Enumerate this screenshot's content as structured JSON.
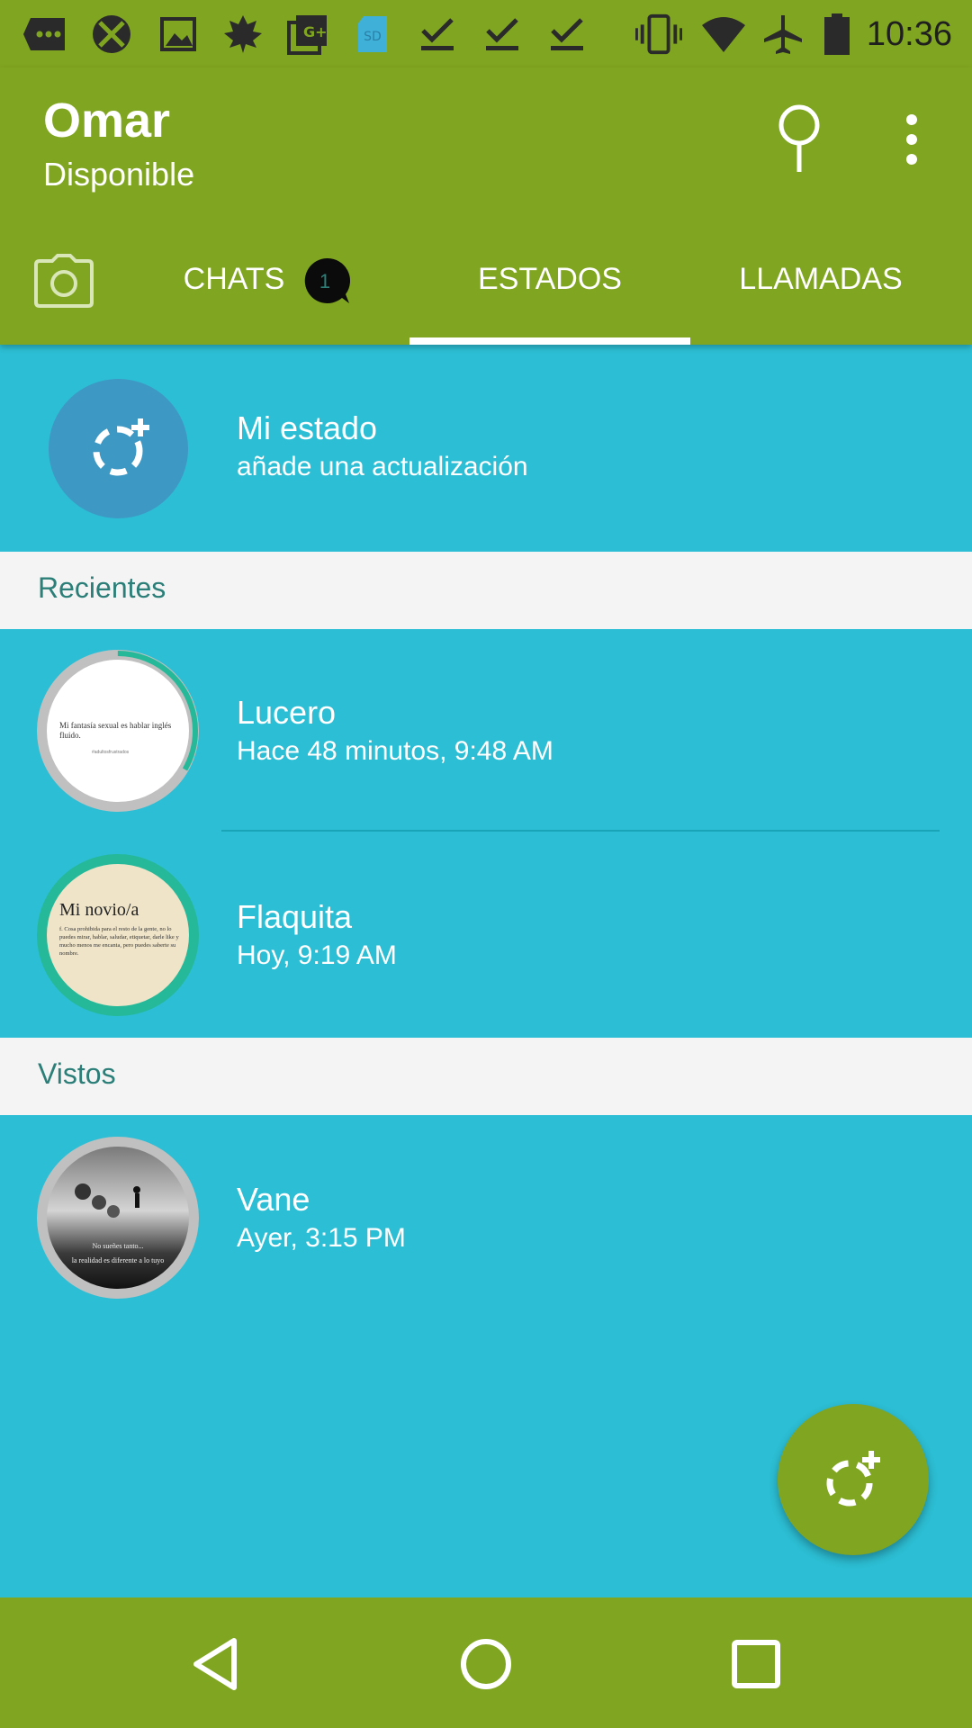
{
  "status_bar": {
    "time": "10:36",
    "icons": [
      "message-icon",
      "xbox-icon",
      "gallery-icon",
      "leaf-icon",
      "gplus-icon",
      "sd-card-icon",
      "download-done-icon",
      "download-done-icon",
      "download-done-icon",
      "vibrate-icon",
      "wifi-icon",
      "airplane-icon",
      "battery-icon"
    ],
    "sd_label": "SD"
  },
  "header": {
    "title": "Omar",
    "subtitle": "Disponible"
  },
  "tabs": [
    {
      "label": "CHATS",
      "badge": "1"
    },
    {
      "label": "ESTADOS",
      "selected": true
    },
    {
      "label": "LLAMADAS"
    }
  ],
  "my_status": {
    "title": "Mi estado",
    "subtitle": "añade una actualización"
  },
  "sections": {
    "recent": "Recientes",
    "viewed": "Vistos"
  },
  "recent_items": [
    {
      "name": "Lucero",
      "time": "Hace 48 minutos, 9:48 AM",
      "thumb_text": "Mi fantasía sexual es hablar inglés fluido.",
      "thumb_sub": "#adultosfrustrados"
    },
    {
      "name": "Flaquita",
      "time": "Hoy, 9:19 AM",
      "thumb_title": "Mi novio/a",
      "thumb_text": "f. Cosa prohibida para el resto de la gente, no lo puedes mirar, hablar, saludar, etiquetar, darle like y mucho menos me encanta, pero puedes saberte su nombre."
    }
  ],
  "viewed_items": [
    {
      "name": "Vane",
      "time": "Ayer, 3:15 PM",
      "thumb_text_1": "No sueñes tanto...",
      "thumb_text_2": "la realidad es diferente a lo tuyo"
    }
  ],
  "colors": {
    "primary": "#80a520",
    "background": "#2cbed4",
    "section_header": "#f4f4f4",
    "section_text": "#2b7f78",
    "avatar_bg": "#3e98c4",
    "unseen_ring": "#25b99a",
    "seen_ring": "#c0c0c0"
  }
}
